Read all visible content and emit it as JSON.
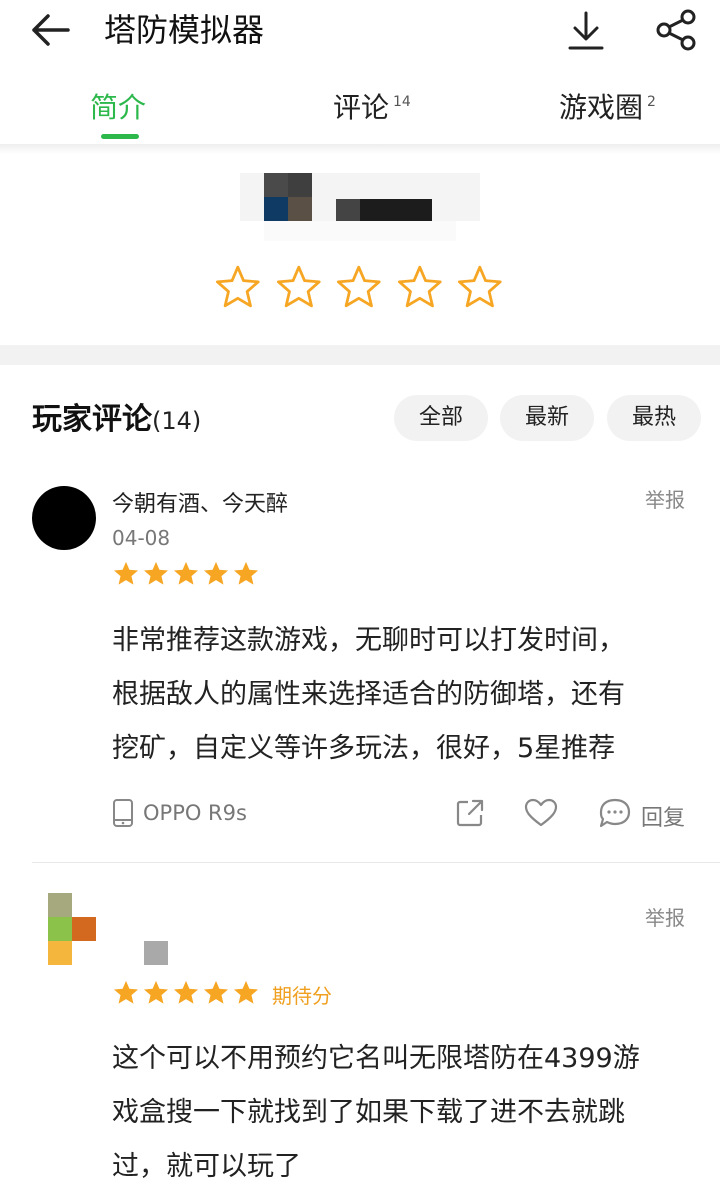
{
  "header": {
    "title": "塔防模拟器",
    "back_icon": "arrow-left-icon",
    "download_icon": "download-icon",
    "share_icon": "share-icon"
  },
  "tabs": [
    {
      "label": "简介",
      "badge": ""
    },
    {
      "label": "评论",
      "badge": "14"
    },
    {
      "label": "游戏圈",
      "badge": "2"
    }
  ],
  "rating": {
    "stars_filled": 0,
    "stars_total": 5
  },
  "comments_section": {
    "title": "玩家评论",
    "count": "(14)",
    "filters": [
      "全部",
      "最新",
      "最热"
    ]
  },
  "comments": [
    {
      "username": "今朝有酒、今天醉",
      "date": "04-08",
      "stars": 5,
      "report": "举报",
      "text_lines": [
        "非常推荐这款游戏，无聊时可以打发时间，",
        "根据敌人的属性来选择适合的防御塔，还有",
        "挖矿，自定义等许多玩法，很好，5星推荐"
      ],
      "device": "OPPO R9s",
      "reply": "回复"
    },
    {
      "username": "",
      "stars": 5,
      "tag": "期待分",
      "report": "举报",
      "text_lines": [
        "这个可以不用预约它名叫无限塔防在4399游",
        "戏盒搜一下就找到了如果下载了进不去就跳",
        "过，就可以玩了"
      ]
    }
  ],
  "colors": {
    "accent": "#2db84c",
    "star": "#f6a623"
  }
}
